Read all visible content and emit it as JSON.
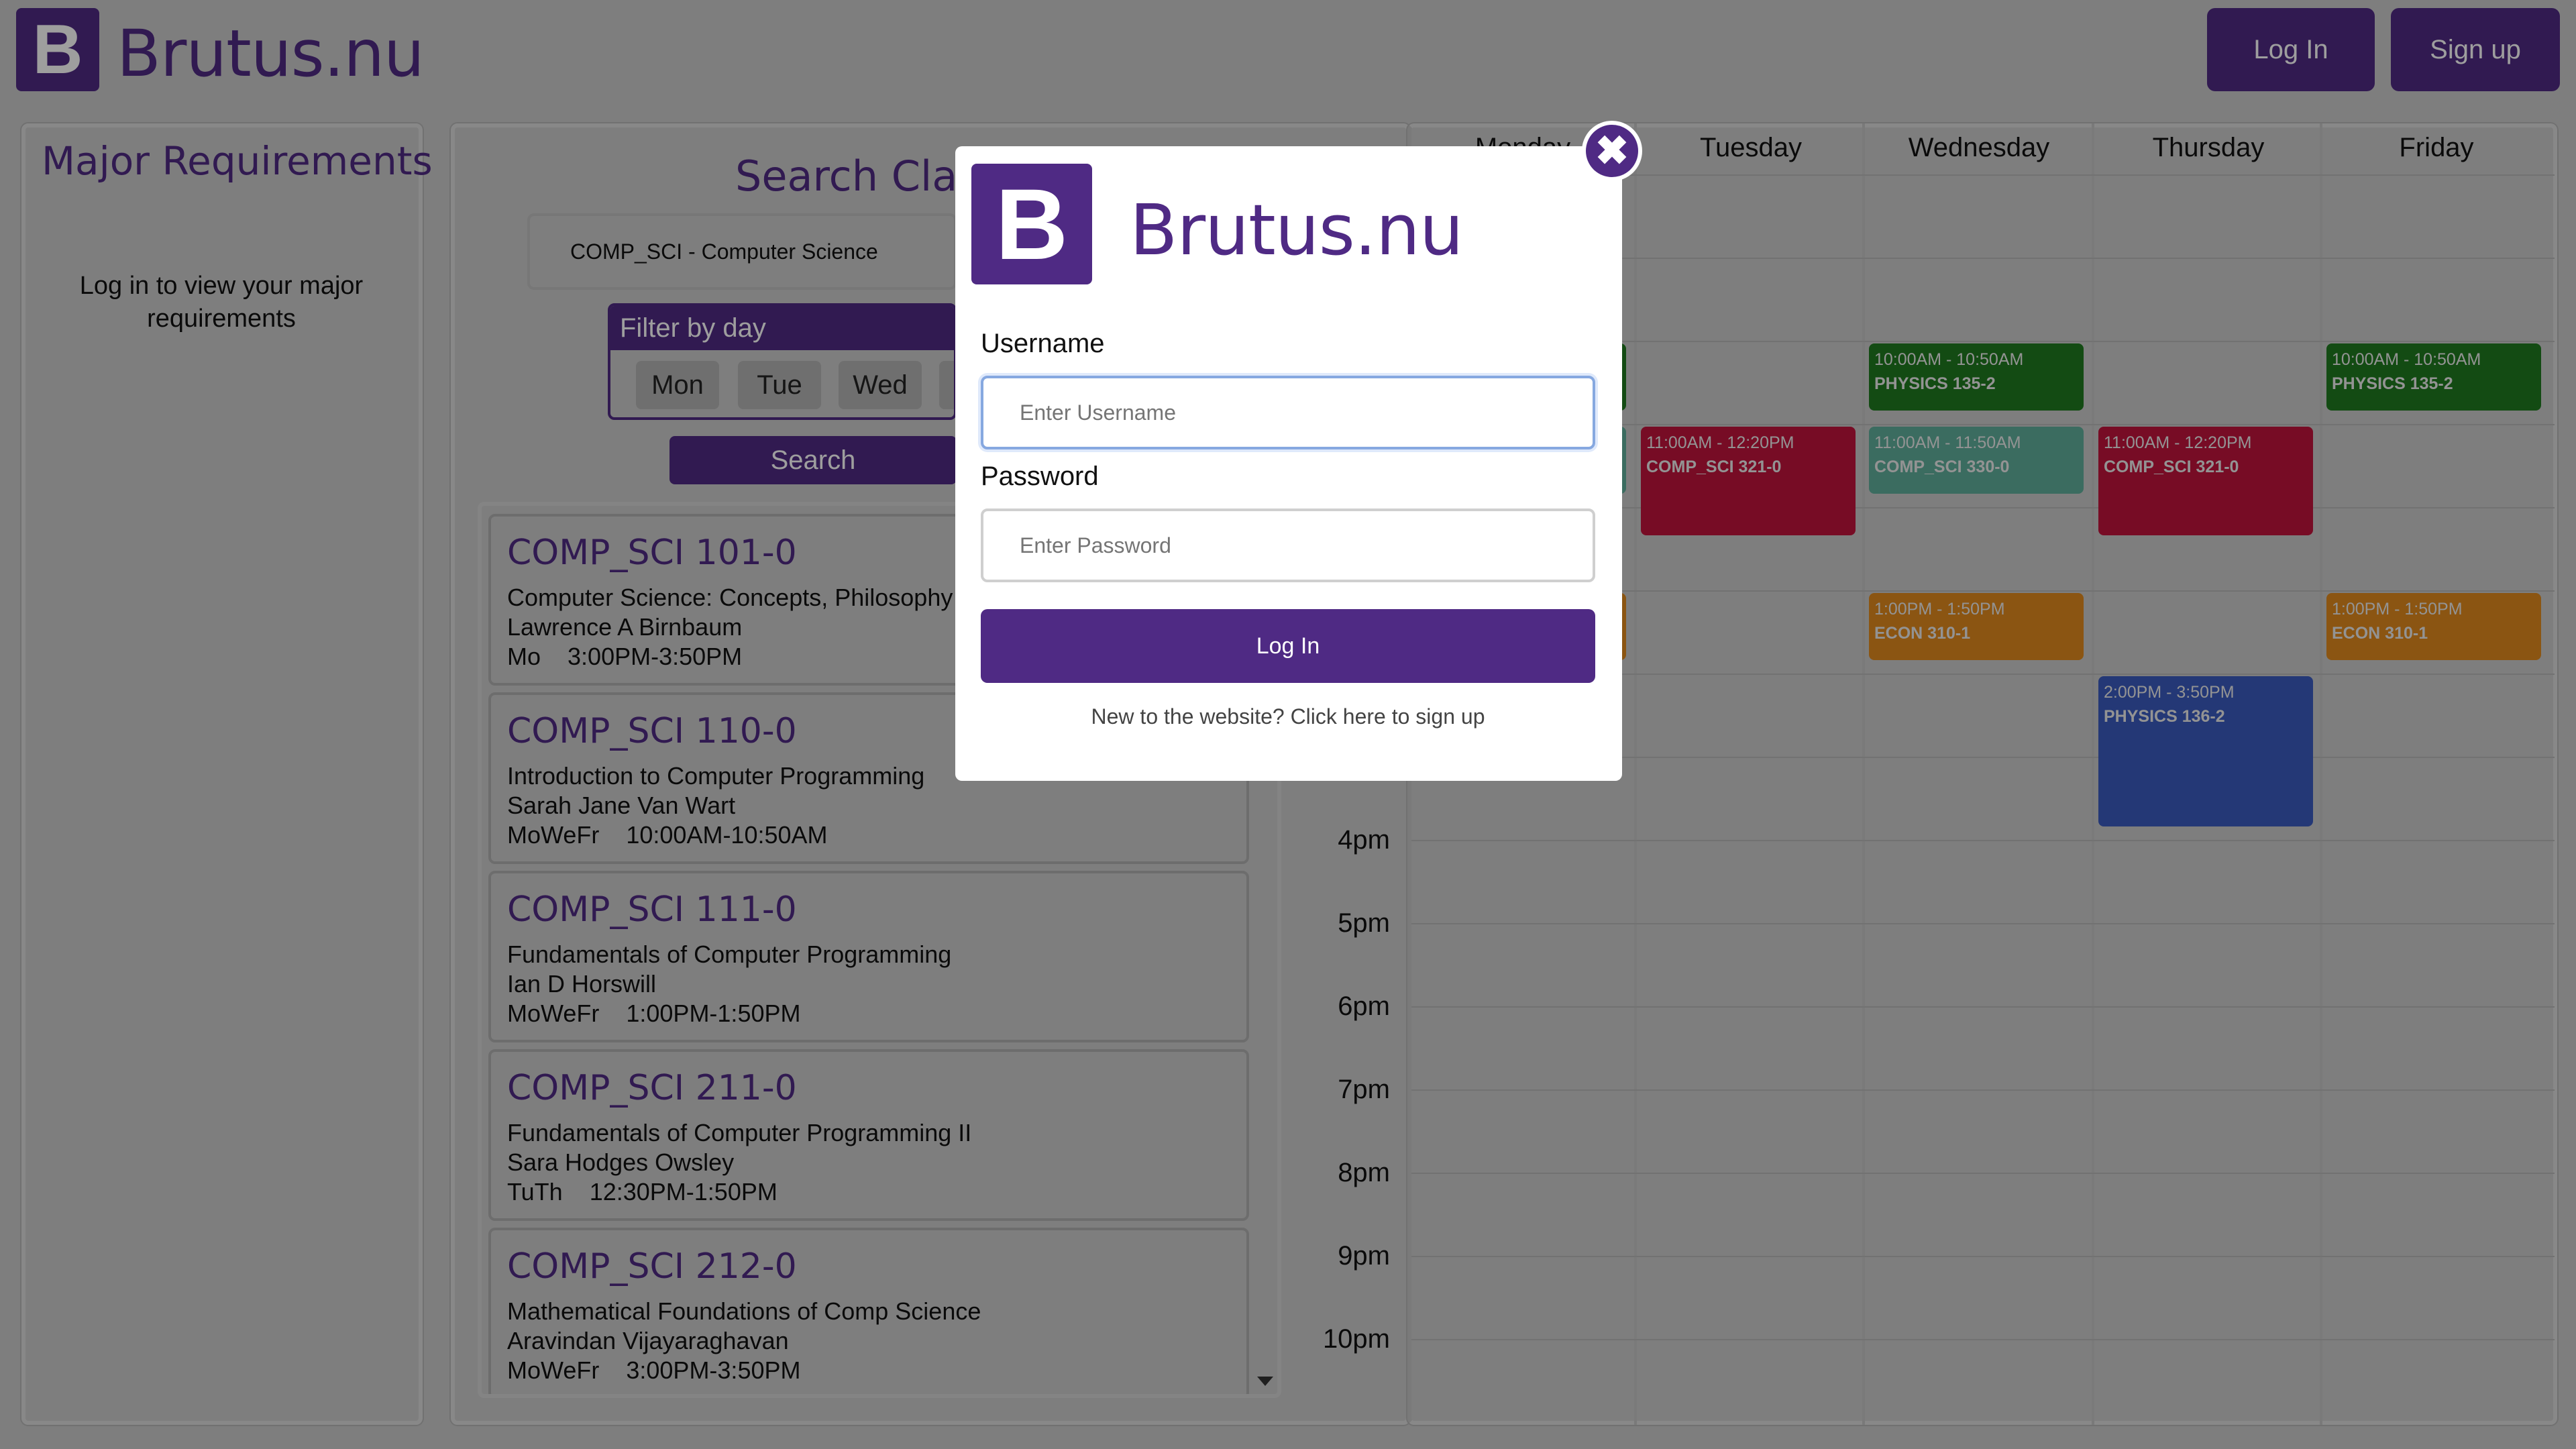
{
  "header": {
    "logo_letter": "B",
    "brand": "Brutus.nu",
    "login_label": "Log In",
    "signup_label": "Sign up"
  },
  "major": {
    "title": "Major Requirements",
    "message": "Log in to view your major requirements"
  },
  "search": {
    "title": "Search Classes",
    "department_value": "COMP_SCI - Computer Science",
    "filter_label": "Filter by day",
    "days": [
      "Mon",
      "Tue",
      "Wed"
    ],
    "button_label": "Search"
  },
  "courses": [
    {
      "code": "COMP_SCI 101-0",
      "title": "Computer Science: Concepts, Philosophy",
      "instructor": "Lawrence A Birnbaum",
      "days": "Mo",
      "time": "3:00PM-3:50PM"
    },
    {
      "code": "COMP_SCI 110-0",
      "title": "Introduction to Computer Programming",
      "instructor": "Sarah Jane Van Wart",
      "days": "MoWeFr",
      "time": "10:00AM-10:50AM"
    },
    {
      "code": "COMP_SCI 111-0",
      "title": "Fundamentals of Computer Programming",
      "instructor": "Ian D Horswill",
      "days": "MoWeFr",
      "time": "1:00PM-1:50PM"
    },
    {
      "code": "COMP_SCI 211-0",
      "title": "Fundamentals of Computer Programming II",
      "instructor": "Sara Hodges Owsley",
      "days": "TuTh",
      "time": "12:30PM-1:50PM"
    },
    {
      "code": "COMP_SCI 212-0",
      "title": "Mathematical Foundations of Comp Science",
      "instructor": "Aravindan Vijayaraghavan",
      "days": "MoWeFr",
      "time": "3:00PM-3:50PM"
    }
  ],
  "calendar": {
    "days": [
      "Monday",
      "Tuesday",
      "Wednesday",
      "Thursday",
      "Friday"
    ],
    "times": [
      "4pm",
      "5pm",
      "6pm",
      "7pm",
      "8pm",
      "9pm",
      "10pm"
    ],
    "events": [
      {
        "time": "10:00AM - 10:50AM",
        "name": "PHYSICS 135-2",
        "color": "#1f7a1f"
      },
      {
        "time": "10:00AM - 10:50AM",
        "name": "PHYSICS 135-2",
        "color": "#1f7a1f"
      },
      {
        "time": "11:00AM - 12:20PM",
        "name": "COMP_SCI 321-0",
        "color": "#c0143c"
      },
      {
        "time": "11:00AM - 11:50AM",
        "name": "COMP_SCI 330-0",
        "color": "#5fae9b"
      },
      {
        "time": "11:00AM - 12:20PM",
        "name": "COMP_SCI 321-0",
        "color": "#c0143c"
      },
      {
        "time": "1:00PM - 1:50PM",
        "name": "ECON 310-1",
        "color": "#e08a1e"
      },
      {
        "time": "1:00PM - 1:50PM",
        "name": "ECON 310-1",
        "color": "#e08a1e"
      },
      {
        "time": "2:00PM - 3:50PM",
        "name": "PHYSICS 136-2",
        "color": "#3b5bbf"
      }
    ]
  },
  "modal": {
    "logo_letter": "B",
    "brand": "Brutus.nu",
    "username_label": "Username",
    "username_placeholder": "Enter Username",
    "password_label": "Password",
    "password_placeholder": "Enter Password",
    "submit_label": "Log In",
    "signup_text": "New to the website? Click here to sign up",
    "close_glyph": "✖"
  },
  "colors": {
    "brand": "#4f2a84",
    "page_background": "#cccccc"
  }
}
